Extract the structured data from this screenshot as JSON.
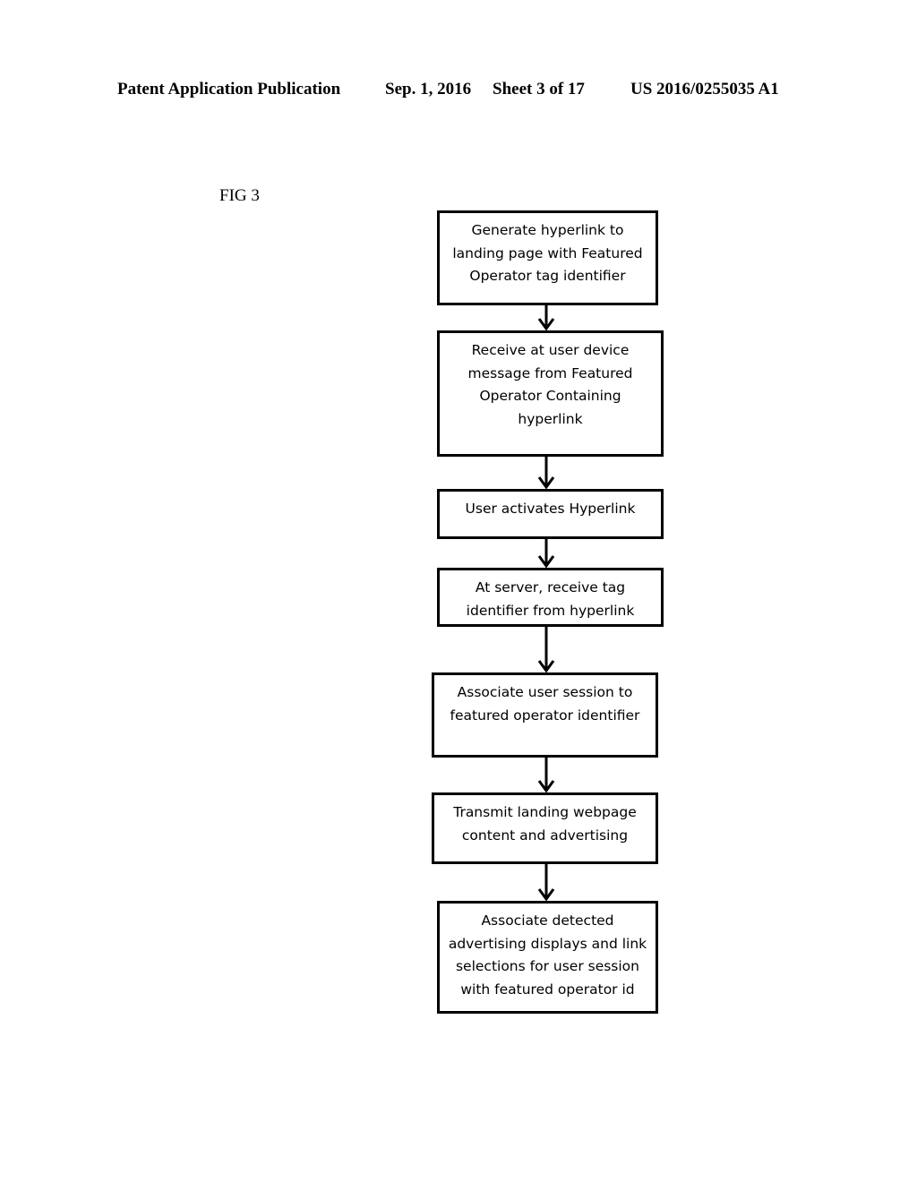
{
  "header": {
    "publication": "Patent Application Publication",
    "date": "Sep. 1, 2016",
    "sheet": "Sheet 3 of 17",
    "number": "US 2016/0255035 A1"
  },
  "figure": {
    "label": "FIG 3"
  },
  "flowchart": {
    "steps": [
      {
        "lines": [
          "Generate hyperlink to",
          "landing page with Featured",
          "Operator tag identifier"
        ]
      },
      {
        "lines": [
          "Receive at user device",
          "message from Featured",
          "Operator Containing",
          "hyperlink"
        ]
      },
      {
        "lines": [
          "User activates Hyperlink"
        ]
      },
      {
        "lines": [
          "At server, receive tag",
          "identifier from hyperlink"
        ]
      },
      {
        "lines": [
          "Associate user session to",
          "featured operator identifier"
        ]
      },
      {
        "lines": [
          "Transmit landing webpage",
          "content and advertising"
        ]
      },
      {
        "lines": [
          "Associate detected",
          "advertising displays and link",
          "selections for user session",
          "with featured operator id"
        ]
      }
    ],
    "connections": [
      [
        0,
        1
      ],
      [
        1,
        2
      ],
      [
        2,
        3
      ],
      [
        3,
        4
      ],
      [
        4,
        5
      ],
      [
        5,
        6
      ]
    ]
  }
}
